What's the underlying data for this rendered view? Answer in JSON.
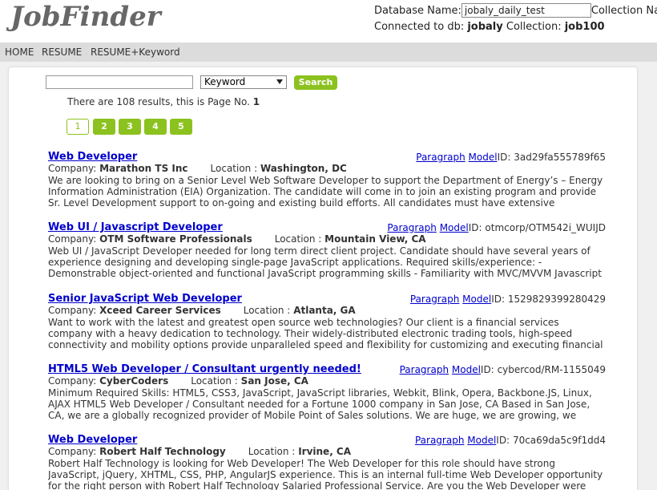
{
  "header": {
    "logo": "JobFinder",
    "db_label": "Database Name:",
    "db_value": "jobaly_daily_test",
    "collection_label": "Collection Name",
    "connected_label": "Connected to db:",
    "connected_db": "jobaly",
    "collection_text": "Collection:",
    "collection_value": "job100"
  },
  "nav": {
    "home": "HOME",
    "resume": "RESUME",
    "resume_keyword": "RESUME+Keyword"
  },
  "search": {
    "query": "",
    "type": "Keyword",
    "button": "Search"
  },
  "results_info": {
    "prefix": "There are",
    "count": "108",
    "middle": "results, this is Page No.",
    "page": "1"
  },
  "pagination": [
    "1",
    "2",
    "3",
    "4",
    "5"
  ],
  "jobs": [
    {
      "title": "Web Developer",
      "paragraph": "Paragraph",
      "model": "Model",
      "id_label": "ID:",
      "id": "3ad29fa555789f65",
      "company_label": "Company:",
      "company": "Marathon TS Inc",
      "location_label": "Location :",
      "location": "Washington, DC",
      "description": "We are looking to bring on a Senior Level Web Software Developer to support the Department of Energy’s – Energy Information Administration (EIA) Organization. The candidate will come in to join an existing program and provide Sr. Level Development support to on-going and existing build efforts. All candidates must have extensive experience in the"
    },
    {
      "title": "Web UI / Javascript Developer",
      "paragraph": "Paragraph",
      "model": "Model",
      "id_label": "ID:",
      "id": "otmcorp/OTM542i_WUIJD",
      "company_label": "Company:",
      "company": "OTM Software Professionals",
      "location_label": "Location :",
      "location": "Mountain View, CA",
      "description": "Web UI / JavaScript Developer needed for long term direct client project. Candidate should have several years of experience designing and developing single-page JavaScript applications. Required skills/experience: - Demonstrable object-oriented and functional JavaScript programming skills - Familiarity with MVC/MVVM Javascript frameworks -"
    },
    {
      "title": "Senior JavaScript Web Developer",
      "paragraph": "Paragraph",
      "model": "Model",
      "id_label": "ID:",
      "id": "1529829399280429",
      "company_label": "Company:",
      "company": "Xceed Career Services",
      "location_label": "Location :",
      "location": "Atlanta, GA",
      "description": "Want to work with the latest and greatest open source web technologies? Our client is a financial services company with a heavy dedication to technology. Their widely-distributed electronic trading tools, high-speed connectivity and mobility options provide unparalleled speed and flexibility for customizing and executing financial and risk management"
    },
    {
      "title": "HTML5 Web Developer / Consultant urgently needed!",
      "paragraph": "Paragraph",
      "model": "Model",
      "id_label": "ID:",
      "id": "cybercod/RM-1155049",
      "company_label": "Company:",
      "company": "CyberCoders",
      "location_label": "Location :",
      "location": "San Jose, CA",
      "description": "Minimum Required Skills: HTML5, CSS3, JavaScript, JavaScript libraries, Webkit, Blink, Opera, Backbone.JS, Linux, AJAX HTML5 Web Developer / Consultant needed for a Fortune 1000 company in San Jose, CA Based in San Jose, CA, we are a globally recognized provider of Mobile Point of Sales solutions. We are huge, we are growing, we believe in"
    },
    {
      "title": "Web Developer",
      "paragraph": "Paragraph",
      "model": "Model",
      "id_label": "ID:",
      "id": "70ca69da5c9f1dd4",
      "company_label": "Company:",
      "company": "Robert Half Technology",
      "location_label": "Location :",
      "location": "Irvine, CA",
      "description": "Robert Half Technology is looking for Web Developer! The Web Developer for this role should have strong JavaScript, jQuery, XHTML, CSS, PHP, AngularJS experience. This is an internal full-time Web Developer opportunity for the right person with Robert Half Technology Salaried Professional Service. Are you the Web Developer were looking for? Robert"
    }
  ]
}
